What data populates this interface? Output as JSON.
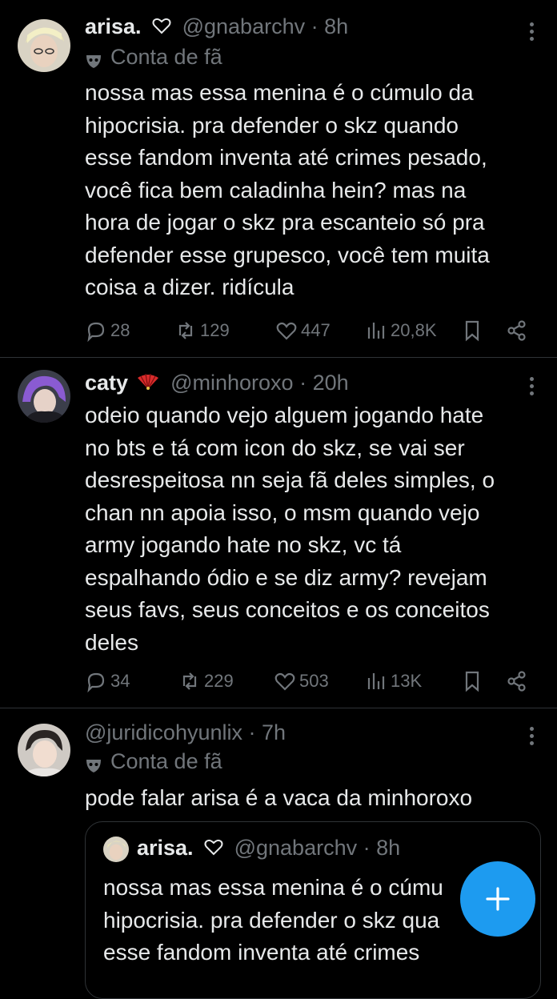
{
  "tweets": [
    {
      "name": "arisa.",
      "handle": "@gnabarchv",
      "time": "· 8h",
      "label": "Conta de fã",
      "text": "nossa mas essa menina é o cúmulo da\nhipocrisia. pra defender o skz quando\nesse fandom inventa até crimes pesado,\nvocê fica bem caladinha hein? mas na\nhora de jogar o skz pra escanteio só pra\ndefender esse grupesco, você tem muita\ncoisa a dizer. ridícula",
      "replies": "28",
      "reposts": "129",
      "likes": "447",
      "views": "20,8K"
    },
    {
      "name": "caty",
      "handle": "@minhoroxo",
      "time": "· 20h",
      "text": "odeio quando vejo alguem jogando hate\nno bts e tá com icon do skz, se vai ser\ndesrespeitosa nn seja fã deles simples, o\nchan nn apoia isso, o msm quando vejo\narmy jogando hate no skz, vc tá\nespalhando ódio e se diz army? revejam\nseus favs, seus conceitos e os conceitos\ndeles",
      "replies": "34",
      "reposts": "229",
      "likes": "503",
      "views": "13K"
    },
    {
      "handle": "@juridicohyunlix",
      "time": "· 7h",
      "label": "Conta de fã",
      "text": "pode falar arisa é a vaca da minhoroxo",
      "quote": {
        "name": "arisa.",
        "handle": "@gnabarchv",
        "time": "· 8h",
        "text": "nossa mas essa menina é o cúmu\nhipocrisia. pra defender o skz qua\nesse fandom inventa até crimes"
      }
    }
  ],
  "colors": {
    "accent": "#1d9bf0",
    "muted": "#71767b",
    "background": "#000000",
    "divider": "#2f3336"
  },
  "fab": {
    "icon": "plus-icon"
  }
}
